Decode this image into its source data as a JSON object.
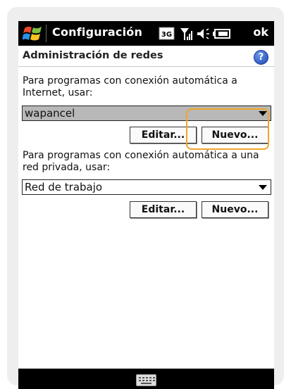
{
  "titlebar": {
    "title": "Configuración",
    "network_type": "3G",
    "ok_label": "ok",
    "icons": [
      "windows-start-icon",
      "3g-icon",
      "signal-icon",
      "volume-icon",
      "battery-icon"
    ]
  },
  "header": {
    "title": "Administración de redes",
    "help_icon": "?"
  },
  "internet_section": {
    "label": "Para programas con conexión automática a Internet, usar:",
    "selected_value": "wapancel",
    "edit_label": "Editar...",
    "new_label": "Nuevo..."
  },
  "private_section": {
    "label": "Para programas con conexión automática a una red privada, usar:",
    "selected_value": "Red de trabajo",
    "edit_label": "Editar...",
    "new_label": "Nuevo..."
  },
  "colors": {
    "highlight": "#f0a52a",
    "selected_combo": "#b8b8b8",
    "titlebar": "#000000",
    "help_icon": "#2a56c6"
  }
}
